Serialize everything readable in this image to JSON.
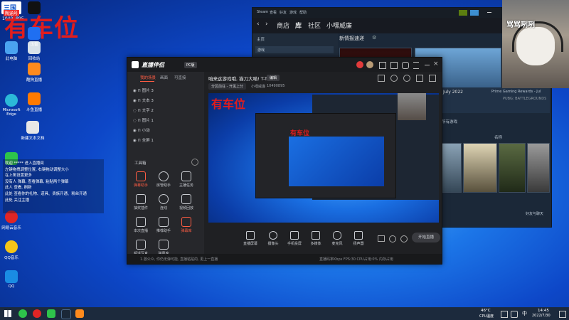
{
  "watermark": {
    "text": "有车位",
    "small_text": "有车位",
    "mini_text": "有车位"
  },
  "badge": {
    "label": "三国",
    "viewers_label": "陶涵号",
    "id": "10490895"
  },
  "desktop_icons": [
    {
      "label": "此电脑",
      "color": "#4aa3f0"
    },
    {
      "label": "回收站",
      "color": "#d8e2ea"
    },
    {
      "label": "Microsoft Edge",
      "color": "#2bb9d8"
    },
    {
      "label": "新建文本文档",
      "color": "#e6e6e6"
    },
    {
      "label": "微信",
      "color": "#2ec34b"
    },
    {
      "label": "网易云音乐",
      "color": "#e02525"
    },
    {
      "label": "QQ音乐",
      "color": "#f4c518"
    },
    {
      "label": "QQ",
      "color": "#1a8ce3"
    },
    {
      "label": "酷狗直播",
      "color": "#ff8a1d"
    },
    {
      "label": "斗鱼直播",
      "color": "#ff7a00"
    },
    {
      "label": "迅雷",
      "color": "#1f6ff2"
    },
    {
      "label": "剪映",
      "color": "#111111"
    }
  ],
  "chat": [
    "欢迎 ***** 进入直播间",
    "左键拖拽调整位置, 右键拖动调整大小",
    "在上角设置更多",
    "没有人 弹幕, 查看弹幕, 粘贴两个弹幕",
    "此人 查看, 刷新",
    "此处 查看你的礼物、道具、贵族开通、粉丝开通",
    "此处 关注主播"
  ],
  "steam": {
    "menu": [
      "Steam",
      "查看",
      "好友",
      "游戏",
      "帮助"
    ],
    "nav": [
      "商店",
      "库",
      "社区",
      "小嘿威廉"
    ],
    "left_header": "主页",
    "filter_label": "游戏",
    "news_title": "新情报速递",
    "promo_title": "July 2022",
    "promo_sub": "Prime Gaming Rewards - Jul",
    "promo_game": "PUBG: BATTLEGROUNDS",
    "section_label": "所有游戏",
    "sort_label": "名称",
    "friends_label": "好友与聊天"
  },
  "app": {
    "name": "直播伴侣",
    "version": "PC版",
    "tabs": [
      "我的场景",
      "画面",
      "可直接"
    ],
    "stream_title": "咱来这游戏哦, 猫刀大喵! T-T",
    "stream_edit": "编辑",
    "category": "分区前往 - 开黑上分",
    "id_label": "小嘿威廉",
    "id_value": "10490895",
    "layers": [
      "图片 3",
      "文本 3",
      "文字 2",
      "图片 1",
      "小动",
      "全屏 1"
    ],
    "tools_title": "工具箱",
    "tools": [
      {
        "label": "弹幕助手",
        "active": true
      },
      {
        "label": "房管助手",
        "active": false
      },
      {
        "label": "主播任务",
        "active": false
      },
      {
        "label": "抽奖插件",
        "active": false
      },
      {
        "label": "连线",
        "active": false
      },
      {
        "label": "视频回放",
        "active": false
      },
      {
        "label": "本次直播",
        "active": false
      },
      {
        "label": "推荐助手",
        "active": false
      },
      {
        "label": "弹幕库",
        "active": true
      },
      {
        "label": "超话写真",
        "active": false
      },
      {
        "label": "弹幕库",
        "active": false
      }
    ],
    "bottom": [
      "直播屏幕",
      "摄像头",
      "手机投屏",
      "多媒体",
      "麦克风",
      "扬声器"
    ],
    "start_button": "开始直播",
    "status_left": "1.激公众, 你仍无弹可能, 直播粘贴的, 更上一直播",
    "status_right": "直播码率Kbps  FPS:30  CPU占用:0%  内存占用"
  },
  "webcam": {
    "overlay": "骂骂咧咧"
  },
  "taskbar": {
    "temp": "46°C",
    "cpu_label": "CPU温度",
    "time": "14:45",
    "date": "2022/7/30",
    "lang": "中"
  }
}
